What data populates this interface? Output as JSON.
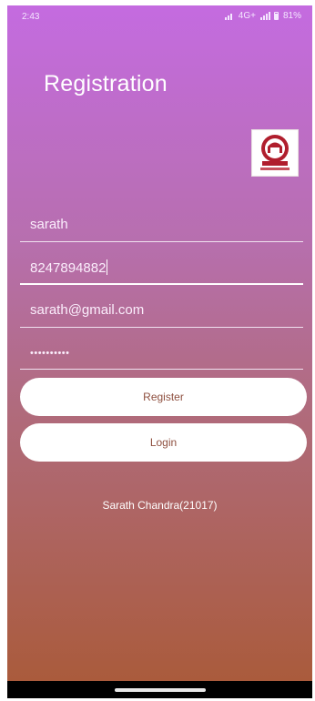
{
  "status_bar": {
    "time": "2:43",
    "icons_text": "4G+",
    "battery": "81%"
  },
  "title": "Registration",
  "fields": {
    "name_value": "sarath",
    "phone_value": "8247894882",
    "email_value": "sarath@gmail.com",
    "password_value": "••••••••••"
  },
  "buttons": {
    "register_label": "Register",
    "login_label": "Login"
  },
  "footer": "Sarath Chandra(21017)",
  "colors": {
    "gradient_top": "#c46be0",
    "gradient_bottom": "#aa5b3c",
    "button_text": "#8e4f3f"
  },
  "icons": {
    "logo": "university-emblem-logo"
  }
}
